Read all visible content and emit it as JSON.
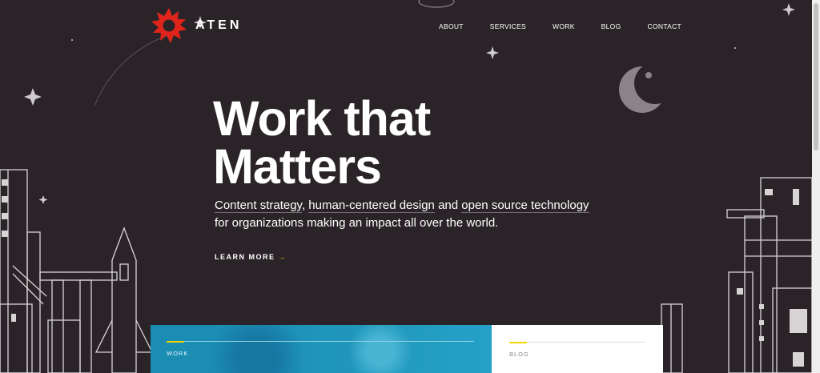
{
  "header": {
    "brand": "ATEN",
    "nav": [
      "ABOUT",
      "SERVICES",
      "WORK",
      "BLOG",
      "CONTACT"
    ]
  },
  "hero": {
    "title_line1": "Work that",
    "title_line2": "Matters",
    "sub_link1": "Content strategy",
    "sub_sep1": ", ",
    "sub_link2": "human-centered design",
    "sub_and": " and ",
    "sub_link3": "open source technology",
    "sub_rest": "for organizations making an impact all over the world.",
    "cta": "LEARN MORE",
    "cta_arrow": "→"
  },
  "cards": {
    "work_label": "WORK",
    "blog_label": "BLOG"
  },
  "colors": {
    "background": "#2a2428",
    "accent": "#f5b800",
    "logo_red": "#e0241b",
    "work_card": "#1b8db3"
  }
}
